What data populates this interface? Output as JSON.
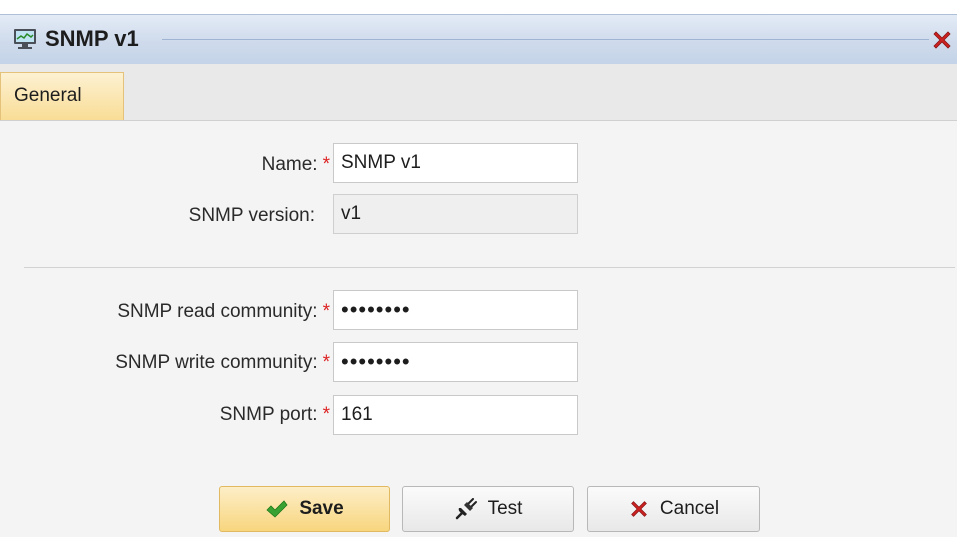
{
  "window": {
    "title": "SNMP v1",
    "title_icon": "monitor-icon",
    "close_icon": "close-icon"
  },
  "tabs": [
    {
      "label": "General",
      "active": true
    }
  ],
  "form": {
    "name": {
      "label": "Name:",
      "required_mark": "*",
      "value": "SNMP v1"
    },
    "version": {
      "label": "SNMP version:",
      "value": "v1"
    },
    "read_community": {
      "label": "SNMP read community:",
      "required_mark": "*",
      "value": "••••••••"
    },
    "write_community": {
      "label": "SNMP write community:",
      "required_mark": "*",
      "value": "••••••••"
    },
    "port": {
      "label": "SNMP port:",
      "required_mark": "*",
      "value": "161"
    }
  },
  "buttons": {
    "save": {
      "label": "Save",
      "icon": "checkmark-icon"
    },
    "test": {
      "label": "Test",
      "icon": "plug-icon"
    },
    "cancel": {
      "label": "Cancel",
      "icon": "x-icon"
    }
  },
  "colors": {
    "required": "#dd2222",
    "save_button": "#f8d67f",
    "active_tab": "#f9dd96",
    "close_icon": "#cc2222",
    "check_icon": "#3aa233"
  }
}
